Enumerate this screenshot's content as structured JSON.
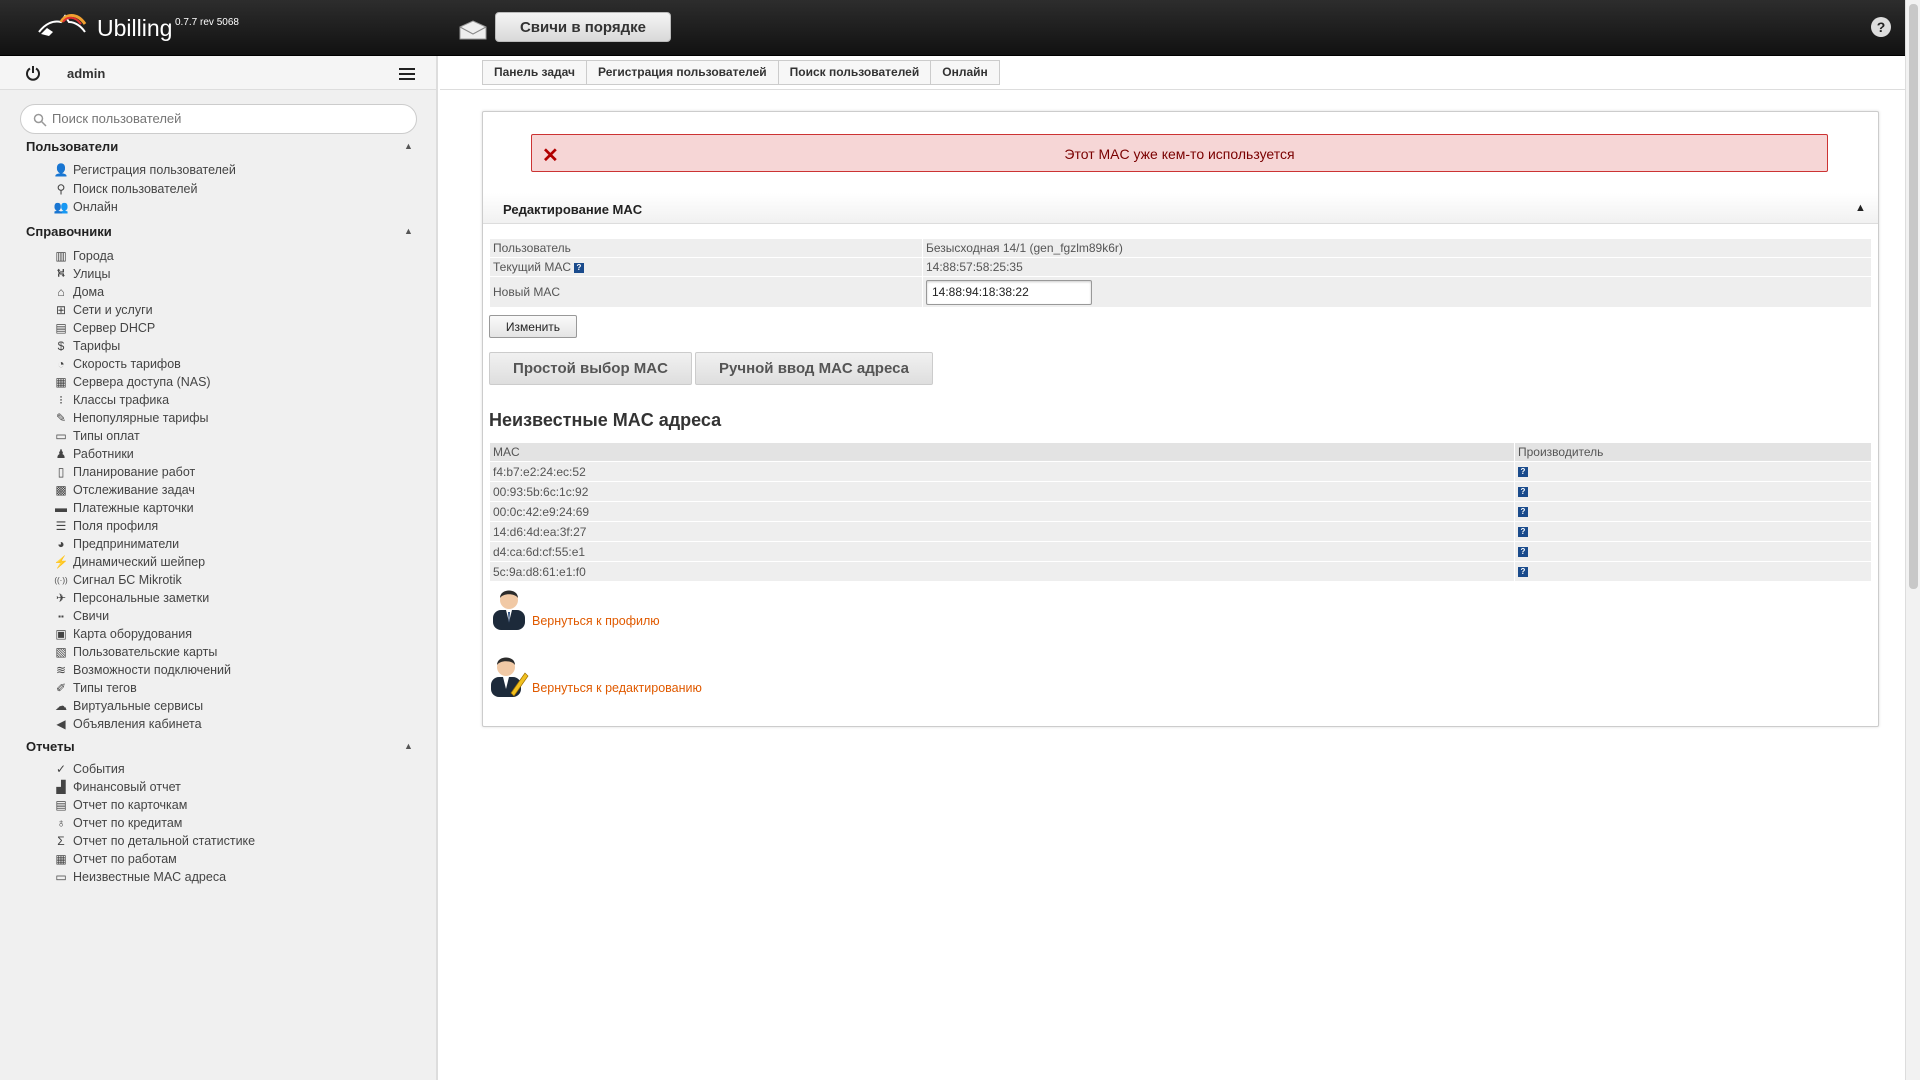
{
  "app": {
    "brand": "Ubilling",
    "version": "0.7.7 rev 5068",
    "status_button": "Свичи в порядке",
    "help": "?"
  },
  "sidebar": {
    "username": "admin",
    "search_placeholder": "Поиск пользователей",
    "sections": [
      {
        "title": "Пользователи",
        "items": [
          {
            "label": "Регистрация пользователей",
            "icon": "user-add-icon"
          },
          {
            "label": "Поиск пользователей",
            "icon": "search-icon"
          },
          {
            "label": "Онлайн",
            "icon": "users-online-icon"
          }
        ]
      },
      {
        "title": "Справочники",
        "items": [
          {
            "label": "Города",
            "icon": "city-icon"
          },
          {
            "label": "Улицы",
            "icon": "street-icon"
          },
          {
            "label": "Дома",
            "icon": "home-icon"
          },
          {
            "label": "Сети и услуги",
            "icon": "network-icon"
          },
          {
            "label": "Сервер DHCP",
            "icon": "server-icon"
          },
          {
            "label": "Тарифы",
            "icon": "dollar-icon"
          },
          {
            "label": "Скорость тарифов",
            "icon": "speedometer-icon"
          },
          {
            "label": "Сервера доступа (NAS)",
            "icon": "nas-icon"
          },
          {
            "label": "Классы трафика",
            "icon": "traffic-light-icon"
          },
          {
            "label": "Непопулярные тарифы",
            "icon": "unpopular-icon"
          },
          {
            "label": "Типы оплат",
            "icon": "payment-icon"
          },
          {
            "label": "Работники",
            "icon": "worker-icon"
          },
          {
            "label": "Планирование работ",
            "icon": "clipboard-icon"
          },
          {
            "label": "Отслеживание задач",
            "icon": "tasks-icon"
          },
          {
            "label": "Платежные карточки",
            "icon": "card-icon"
          },
          {
            "label": "Поля профиля",
            "icon": "profile-fields-icon"
          },
          {
            "label": "Предприниматели",
            "icon": "pie-chart-icon"
          },
          {
            "label": "Динамический шейпер",
            "icon": "shaper-icon"
          },
          {
            "label": "Сигнал БС Mikrotik",
            "icon": "signal-icon"
          },
          {
            "label": "Персональные заметки",
            "icon": "pin-icon"
          },
          {
            "label": "Свичи",
            "icon": "switch-icon"
          },
          {
            "label": "Карта оборудования",
            "icon": "map-icon"
          },
          {
            "label": "Пользовательские карты",
            "icon": "user-map-icon"
          },
          {
            "label": "Возможности подключений",
            "icon": "connection-icon"
          },
          {
            "label": "Типы тегов",
            "icon": "tag-icon"
          },
          {
            "label": "Виртуальные сервисы",
            "icon": "cloud-icon"
          },
          {
            "label": "Объявления кабинета",
            "icon": "megaphone-icon"
          }
        ]
      },
      {
        "title": "Отчеты",
        "items": [
          {
            "label": "События",
            "icon": "check-circle-icon"
          },
          {
            "label": "Финансовый отчет",
            "icon": "finance-icon"
          },
          {
            "label": "Отчет по карточкам",
            "icon": "card-report-icon"
          },
          {
            "label": "Отчет по кредитам",
            "icon": "credit-icon"
          },
          {
            "label": "Отчет по детальной статистике",
            "icon": "sigma-icon"
          },
          {
            "label": "Отчет по работам",
            "icon": "works-icon"
          },
          {
            "label": "Неизвестные MAC адреса",
            "icon": "mac-icon"
          }
        ]
      }
    ]
  },
  "breadcrumb": [
    "Панель задач",
    "Регистрация пользователей",
    "Поиск пользователей",
    "Онлайн"
  ],
  "alert": {
    "text": "Этот MAC уже кем-то используется",
    "icon": "close-icon",
    "color": "#b10000"
  },
  "edit_mac": {
    "title": "Редактирование MAC",
    "user_label": "Пользователь",
    "user_value": "Безысходная 14/1 (gen_fgzlm89k6r)",
    "current_mac_label": "Текущий MAC",
    "current_mac_value": "14:88:57:58:25:35",
    "new_mac_label": "Новый MAC",
    "new_mac_value": "14:88:94:18:38:22",
    "change_button": "Изменить",
    "tab_simple": "Простой выбор MAC",
    "tab_manual": "Ручной ввод MAC адреса"
  },
  "unknown_macs": {
    "title": "Неизвестные MAC адреса",
    "columns": [
      "MAC",
      "Производитель"
    ],
    "rows": [
      "f4:b7:e2:24:ec:52",
      "00:93:5b:6c:1c:92",
      "00:0c:42:e9:24:69",
      "14:d6:4d:ea:3f:27",
      "d4:ca:6d:cf:55:e1",
      "5c:9a:d8:61:e1:f0"
    ]
  },
  "links": {
    "back_profile": "Вернуться к профилю",
    "back_edit": "Вернуться к редактированию"
  },
  "colors": {
    "link": "#e05a00",
    "alert_bg": "#f6d6d6",
    "help_square": "#1a4b8c"
  }
}
